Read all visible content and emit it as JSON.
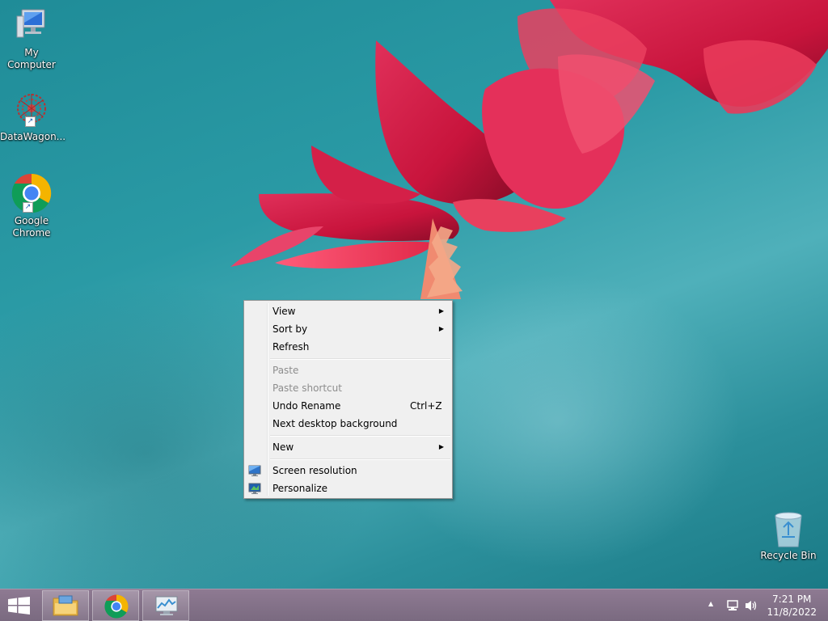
{
  "desktop": {
    "icons": [
      {
        "label": "My Computer"
      },
      {
        "label": "DataWagon..."
      },
      {
        "label": "Google Chrome"
      },
      {
        "label": "Recycle Bin"
      }
    ]
  },
  "context_menu": {
    "items": {
      "view": "View",
      "sort_by": "Sort by",
      "refresh": "Refresh",
      "paste": "Paste",
      "paste_shortcut": "Paste shortcut",
      "undo_rename": "Undo Rename",
      "undo_rename_shortcut": "Ctrl+Z",
      "next_background": "Next desktop background",
      "new": "New",
      "screen_resolution": "Screen resolution",
      "personalize": "Personalize"
    },
    "submenu_arrow": "▶"
  },
  "taskbar": {
    "clock_time": "7:21 PM",
    "clock_date": "11/8/2022",
    "tray_arrow": "▲"
  },
  "colors": {
    "desktop_teal": "#2a9aa5",
    "taskbar": "#857289",
    "menu_bg": "#f0f0f0"
  }
}
